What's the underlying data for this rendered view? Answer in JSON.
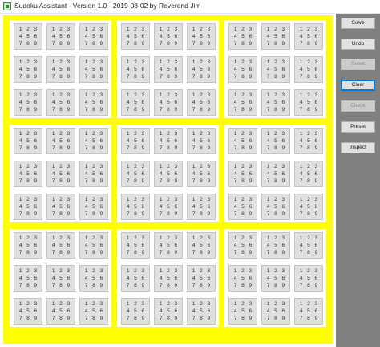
{
  "window": {
    "title": "Sudoku Assistant - Version 1.0 - 2019-08-02 by Reverend Jim",
    "icon": "sudoku-app-icon"
  },
  "board": {
    "highlight_color": "#ffff00",
    "cell_color": "#e0e0e0",
    "candidates": [
      "1",
      "2",
      "3",
      "4",
      "5",
      "6",
      "7",
      "8",
      "9"
    ]
  },
  "sidebar": {
    "background": "#808080",
    "buttons": [
      {
        "id": "solve",
        "label": "Solve",
        "enabled": true,
        "focused": false
      },
      {
        "id": "undo",
        "label": "Undo",
        "enabled": true,
        "focused": false
      },
      {
        "id": "reset",
        "label": "Reset",
        "enabled": false,
        "focused": false
      },
      {
        "id": "clear",
        "label": "Clear",
        "enabled": true,
        "focused": true
      },
      {
        "id": "check",
        "label": "Check",
        "enabled": false,
        "focused": false
      },
      {
        "id": "preset",
        "label": "Preset",
        "enabled": true,
        "focused": false
      },
      {
        "id": "inspect",
        "label": "Inspect",
        "enabled": true,
        "focused": false
      }
    ]
  }
}
